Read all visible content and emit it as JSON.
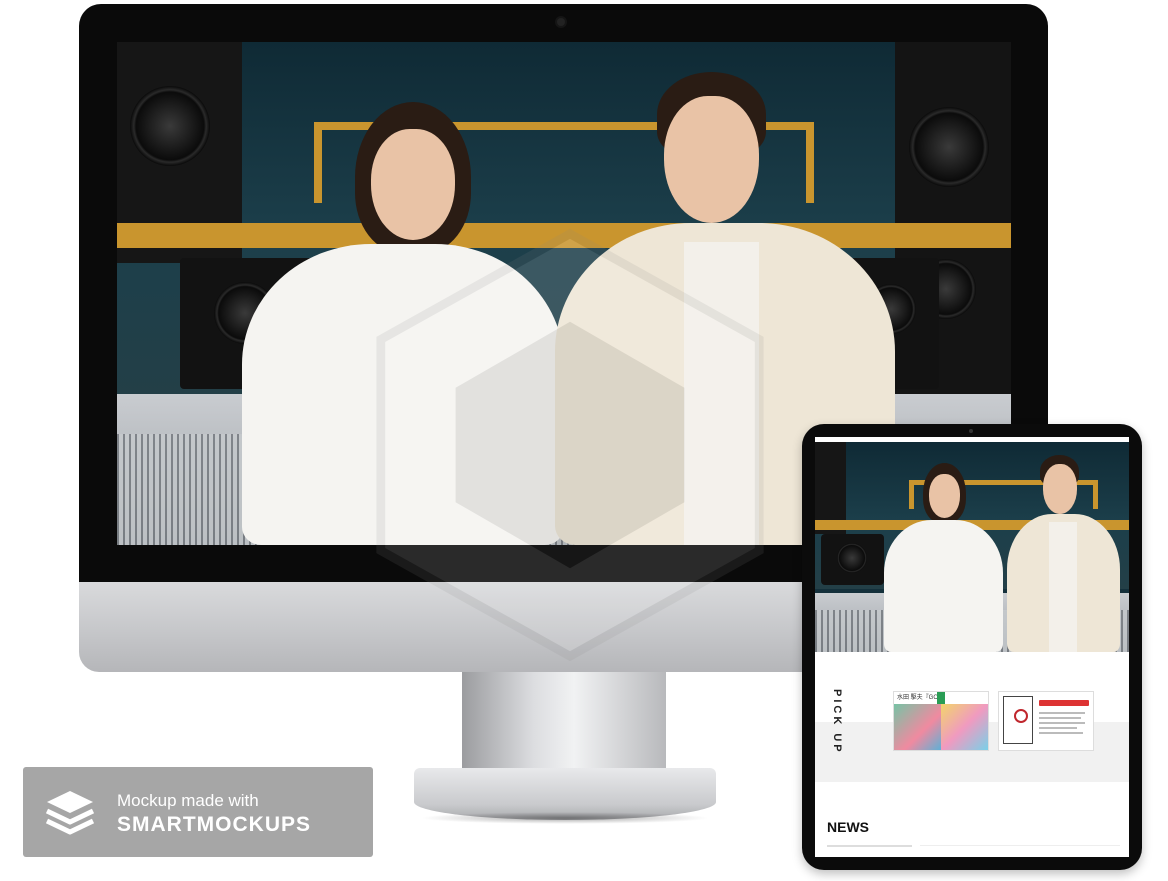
{
  "imac": {
    "photo_alt": "Two people in white outfits smiling in a recording studio"
  },
  "ipad": {
    "pickup_label": "PICK UP",
    "news_label": "NEWS",
    "card1_heading": "水田 駆夫『GO』",
    "card2_heading": "『あなたのいない世界で』"
  },
  "badge": {
    "line1": "Mockup made with",
    "line2": "SMARTMOCKUPS",
    "icon": "layers-icon"
  },
  "colors": {
    "studio_wood": "#c9952e",
    "badge_bg": "#a6a6a6",
    "device_black": "#0b0b0b"
  }
}
